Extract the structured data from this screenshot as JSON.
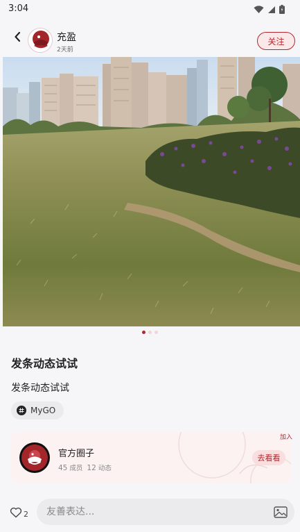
{
  "status_bar": {
    "time": "3:04",
    "icons": [
      "wifi-icon",
      "signal-icon",
      "battery-icon"
    ]
  },
  "header": {
    "back_icon": "chevron-left-icon",
    "username": "充盈",
    "post_time": "2天前",
    "follow_label": "关注"
  },
  "photo": {
    "description_icon": "photo-park-lawn",
    "page_count": 3,
    "active_page": 1
  },
  "post": {
    "title": "发条动态试试",
    "body": "发条动态试试",
    "tag": "MyGO"
  },
  "circle_card": {
    "join_label": "加入",
    "name": "官方圈子",
    "members_count": "45",
    "members_label": "成员",
    "posts_count": "12",
    "posts_label": "动态",
    "visit_label": "去看看"
  },
  "bottom_bar": {
    "like_count": "2",
    "comment_placeholder": "友善表达..."
  },
  "colors": {
    "accent": "#b3262c",
    "background": "#f6f6f8",
    "card_background": "#fdf2f2"
  }
}
